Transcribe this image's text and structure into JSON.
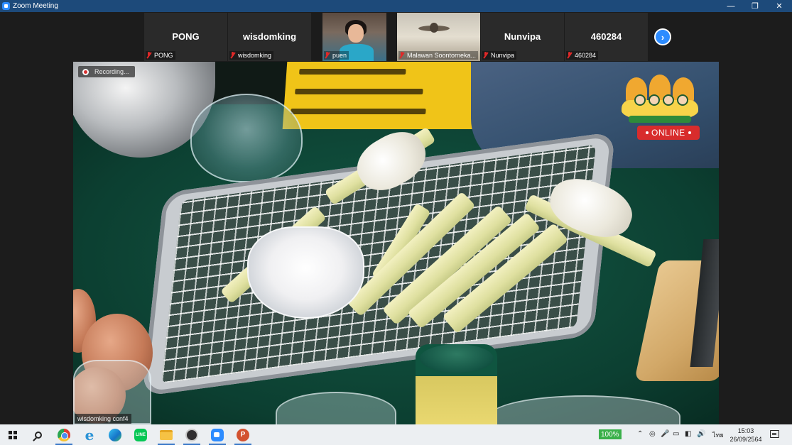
{
  "window": {
    "title": "Zoom Meeting",
    "controls": {
      "minimize": "—",
      "maximize": "❐",
      "close": "✕"
    }
  },
  "gallery": {
    "tiles": [
      {
        "name": "PONG",
        "caption": "PONG",
        "video": false
      },
      {
        "name": "wisdomking",
        "caption": "wisdomking",
        "video": false
      },
      {
        "name": "",
        "caption": "puen",
        "video": true
      },
      {
        "name": "",
        "caption": "Malawan Soontorneka...",
        "video": true
      },
      {
        "name": "Nunvipa",
        "caption": "Nunvipa",
        "video": false
      },
      {
        "name": "460284",
        "caption": "460284",
        "video": false
      }
    ],
    "next_label": "›"
  },
  "main": {
    "recording_label": "Recording...",
    "speaker_name": "wisdomking conf4",
    "logo_badge": "ONLINE"
  },
  "taskbar": {
    "battery_percent": "100%",
    "language": "ไทย",
    "time": "15:03",
    "date": "26/09/2564",
    "apps": {
      "line": "LINE",
      "ie": "e",
      "ppt": "P"
    },
    "tray_icons": [
      "⌃",
      "◎",
      "🎤",
      "▭",
      "◧",
      "🔊"
    ]
  },
  "colors": {
    "zoom_blue": "#2d8cff",
    "titlebar": "#1d4a7a",
    "mic_muted": "#e02828",
    "battery_green": "#3ab04a"
  }
}
